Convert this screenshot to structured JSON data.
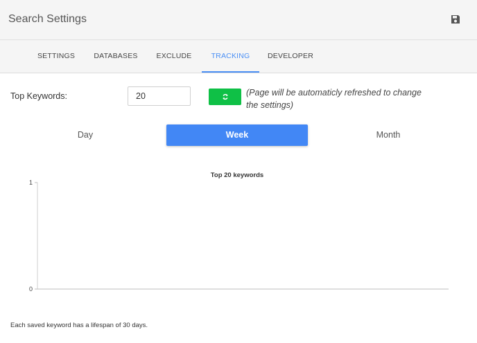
{
  "header": {
    "title": "Search Settings",
    "save_icon": "floppy-disk-icon"
  },
  "tabs": [
    {
      "label": "SETTINGS",
      "active": false
    },
    {
      "label": "DATABASES",
      "active": false
    },
    {
      "label": "EXCLUDE",
      "active": false
    },
    {
      "label": "TRACKING",
      "active": true
    },
    {
      "label": "DEVELOPER",
      "active": false
    }
  ],
  "keywords": {
    "label": "Top Keywords:",
    "value": "20",
    "refresh_icon": "refresh-icon",
    "note": "(Page will be automaticly refreshed to change the settings)"
  },
  "periods": [
    {
      "label": "Day",
      "active": false
    },
    {
      "label": "Week",
      "active": true
    },
    {
      "label": "Month",
      "active": false
    }
  ],
  "chart_data": {
    "type": "bar",
    "title": "Top 20 keywords",
    "categories": [],
    "values": [],
    "ylim": [
      0,
      1
    ],
    "yticks": [
      "0",
      "1"
    ],
    "xlabel": "",
    "ylabel": "",
    "grid": false
  },
  "footer": {
    "note": "Each saved keyword has a lifespan of 30 days."
  },
  "colors": {
    "accent": "#4287f5",
    "refresh": "#0fc046",
    "header_bg": "#f5f5f5"
  }
}
